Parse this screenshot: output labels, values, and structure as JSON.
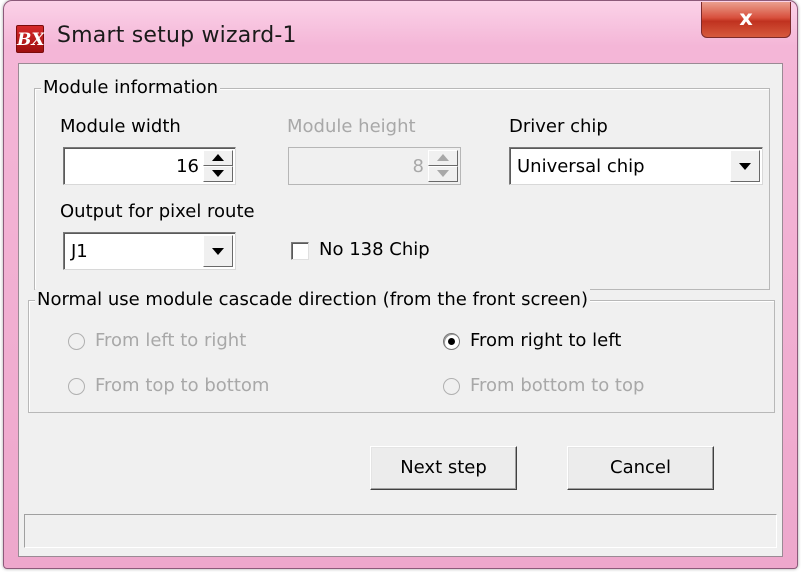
{
  "window": {
    "title": "Smart setup wizard-1",
    "app_icon_text": "BX",
    "close_label": "x"
  },
  "module_info": {
    "group_title": "Module information",
    "width_label": "Module width",
    "width_value": "16",
    "height_label": "Module height",
    "height_value": "8",
    "driver_label": "Driver chip",
    "driver_value": "Universal chip",
    "output_label": "Output for pixel route",
    "output_value": "J1",
    "no138_label": "No 138 Chip"
  },
  "cascade": {
    "group_title": "Normal use module cascade direction (from the front screen)",
    "options": [
      {
        "label": "From left to right",
        "selected": false,
        "enabled": false
      },
      {
        "label": "From right to left",
        "selected": true,
        "enabled": true
      },
      {
        "label": "From top to bottom",
        "selected": false,
        "enabled": false
      },
      {
        "label": "From bottom to top",
        "selected": false,
        "enabled": false
      }
    ]
  },
  "buttons": {
    "next": "Next step",
    "cancel": "Cancel"
  },
  "colors": {
    "title_bar": "#f4b6d7",
    "close_button": "#d0402c",
    "dialog_bg": "#f0f0f0",
    "disabled_text": "#a8a8a8"
  }
}
